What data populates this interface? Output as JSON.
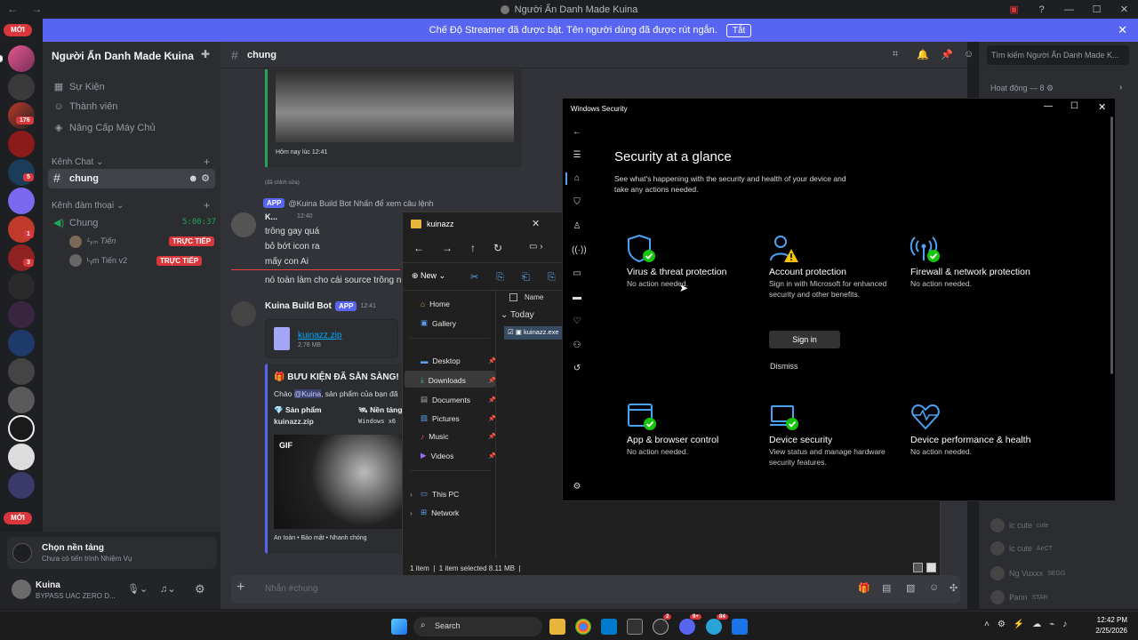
{
  "window_title": "Người Ẩn Danh Made Kuina",
  "title_nav": "← →",
  "title_controls": [
    "▣",
    "?",
    "—",
    "☐",
    "✕"
  ],
  "streamer_banner": {
    "text": "Chế Độ Streamer đã được bật. Tên người dùng đã được rút ngắn.",
    "button": "Tắt",
    "close": "✕"
  },
  "rail": {
    "new_label_top": "MỚI",
    "new_label_bottom": "MỚI",
    "badges": [
      "176",
      "5",
      "1",
      "3"
    ]
  },
  "server": {
    "name": "Người Ẩn Danh Made Kuina"
  },
  "sidebar": {
    "items": [
      {
        "label": "Sự Kiện",
        "icon": "calendar-icon"
      },
      {
        "label": "Thành viên",
        "icon": "members-icon"
      },
      {
        "label": "Nâng Cấp Máy Chủ",
        "icon": "boost-icon"
      }
    ],
    "text_category": "Kênh Chat",
    "active_channel": "chung",
    "voice_category": "Kênh đàm thoại",
    "voice_channel": "Chung",
    "voice_timer": "5:00:37",
    "voice_users": [
      {
        "name": "ᴸᵧₘ Tiến",
        "badge": "TRỰC TIẾP"
      },
      {
        "name": "ᴸᵧm Tiến v2",
        "badge": "TRỰC TIẾP"
      }
    ]
  },
  "user_panel": {
    "quest_title": "Chọn nền tảng",
    "quest_sub": "Chưa có tiến trình Nhiệm Vụ",
    "username": "Kuina",
    "status": "BYPASS UAC ZERO D..."
  },
  "chat": {
    "channel": "chung",
    "search_placeholder": "Tìm kiếm Người Ẩn Danh Made K...",
    "img_time": "Hôm nay lúc 12:41",
    "edited": "(đã chỉnh sửa)",
    "reply_line": "@Kuina Build Bot Nhấn để xem câu lệnh",
    "app_tag": "APP",
    "msg1_author": "K...",
    "msg1_time": "12:40",
    "msg1_lines": [
      "trông gay quá",
      "bỏ bớt icon ra",
      "mấy con Ai"
    ],
    "msg2_line": "nó toàn làm cho cái source trông n",
    "bot_name": "Kuina Build Bot",
    "bot_time": "12:41",
    "file_name": "kuinazz.zip",
    "file_size": "2.78 MB",
    "embed_title": "BƯU KIỆN ĐÃ SẴN SÀNG!",
    "embed_greet_prefix": "Chào ",
    "embed_greet_mention": "@Kuina",
    "embed_greet_suffix": ", sản phẩm của bạn đã",
    "embed_field1_name": "Sản phẩm",
    "embed_field1_value": "kuinazz.zip",
    "embed_field2_name": "Nền tảng",
    "embed_field2_value": "Windows x6",
    "gif_label": "GIF",
    "embed_footer": "An toàn • Bảo mật • Nhanh chóng",
    "composer_placeholder": "Nhắn #chung"
  },
  "members": {
    "heading": "Hoạt động — 8",
    "rows": [
      {
        "name": "lc cute",
        "tag": "cute"
      },
      {
        "name": "lc cute",
        "tag": "AeCT"
      },
      {
        "name": "Ng Vuxxx",
        "tag": "SEGG"
      },
      {
        "name": "Ꝑann",
        "tag": "STAR"
      }
    ]
  },
  "win_security": {
    "title": "Windows Security",
    "heading": "Security at a glance",
    "subtitle": "See what's happening with the security and health of your device and take any actions needed.",
    "tiles": [
      {
        "title": "Virus & threat protection",
        "desc": "No action needed.",
        "icon": "shield-check-icon"
      },
      {
        "title": "Account protection",
        "desc": "Sign in with Microsoft for enhanced security and other benefits.",
        "icon": "account-warning-icon"
      },
      {
        "title": "Firewall & network protection",
        "desc": "No action needed.",
        "icon": "wifi-check-icon"
      },
      {
        "title": "App & browser control",
        "desc": "No action needed.",
        "icon": "app-browser-check-icon"
      },
      {
        "title": "Device security",
        "desc": "View status and manage hardware security features.",
        "icon": "laptop-check-icon"
      },
      {
        "title": "Device performance & health",
        "desc": "No action needed.",
        "icon": "heart-pulse-icon"
      }
    ],
    "signin_label": "Sign in",
    "dismiss_label": "Dismiss"
  },
  "explorer": {
    "title": "kuinazz",
    "new_label": "New",
    "nav": [
      {
        "label": "Home",
        "icon": "home-icon"
      },
      {
        "label": "Gallery",
        "icon": "gallery-icon"
      },
      {
        "label": "Desktop",
        "icon": "desktop-icon"
      },
      {
        "label": "Downloads",
        "icon": "downloads-icon"
      },
      {
        "label": "Documents",
        "icon": "documents-icon"
      },
      {
        "label": "Pictures",
        "icon": "pictures-icon"
      },
      {
        "label": "Music",
        "icon": "music-icon"
      },
      {
        "label": "Videos",
        "icon": "videos-icon"
      },
      {
        "label": "This PC",
        "icon": "pc-icon"
      },
      {
        "label": "Network",
        "icon": "network-icon"
      }
    ],
    "col_name": "Name",
    "group": "Today",
    "file": "kuinazz.exe",
    "status_items": "1 item",
    "status_selected": "1 item selected  8.11 MB"
  },
  "taskbar": {
    "search": "Search",
    "time": "12:42 PM",
    "date": "2/25/2026",
    "badge_a": "2",
    "badge_b": "9+",
    "badge_c": "84"
  }
}
